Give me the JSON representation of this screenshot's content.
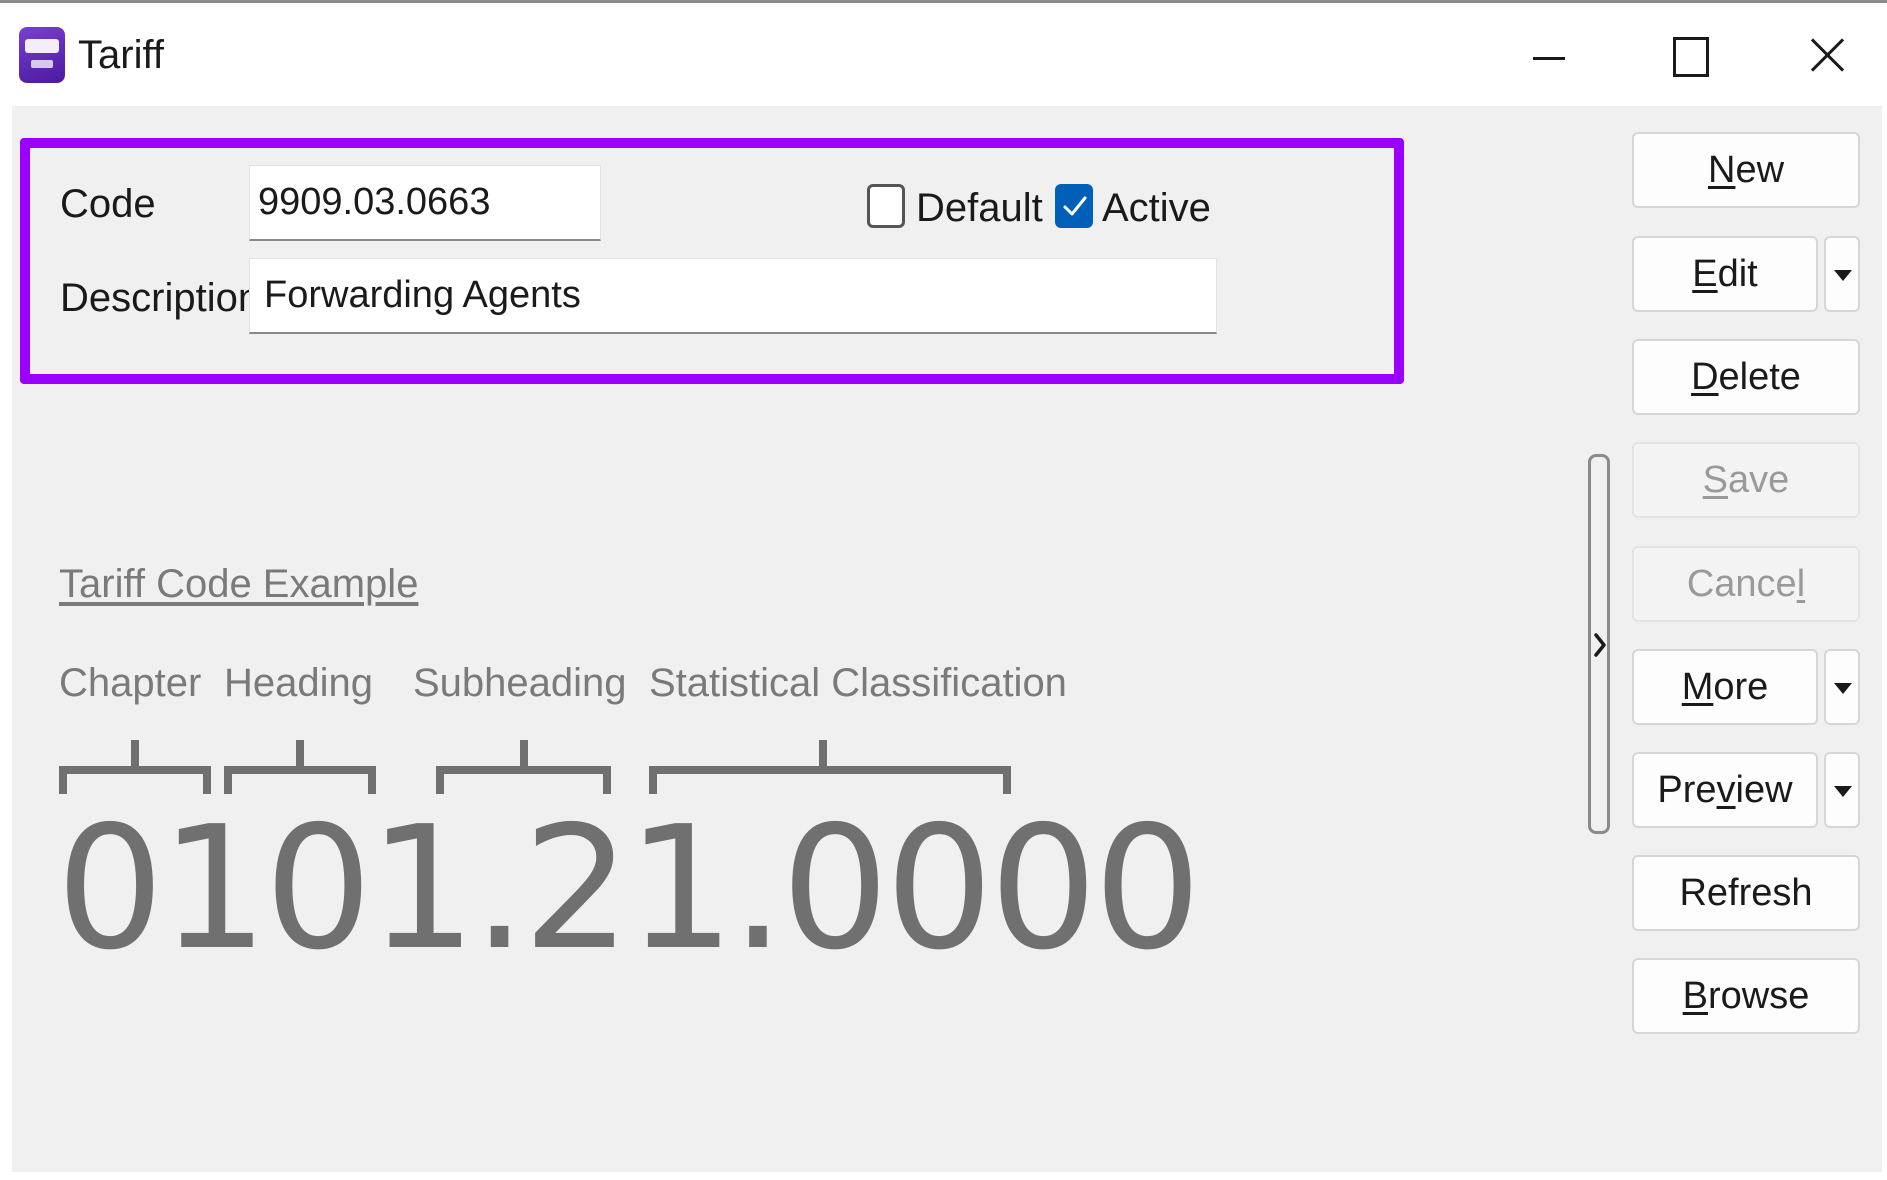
{
  "window": {
    "title": "Tariff",
    "controls": [
      "minimize-icon",
      "maximize-icon",
      "close-icon"
    ],
    "app_icon": "app-logo-icon"
  },
  "form": {
    "code_label": "Code",
    "code_value": "9909.03.0663",
    "description_label": "Description",
    "description_value": "Forwarding Agents",
    "default_label": "Default",
    "default_checked": false,
    "active_label": "Active",
    "active_checked": true
  },
  "example": {
    "link_text": "Tariff Code Example",
    "segments": {
      "chapter": "Chapter",
      "heading": "Heading",
      "subheading": "Subheading",
      "statistical": "Statistical Classification"
    },
    "code": "0101.21.0000"
  },
  "buttons": {
    "new": {
      "before": "",
      "access": "N",
      "after": "ew"
    },
    "edit": {
      "before": "",
      "access": "E",
      "after": "dit"
    },
    "delete": {
      "before": "",
      "access": "D",
      "after": "elete"
    },
    "save": {
      "before": "",
      "access": "S",
      "after": "ave"
    },
    "cancel": {
      "before": "Cance",
      "access": "l",
      "after": ""
    },
    "more": {
      "before": "",
      "access": "M",
      "after": "ore"
    },
    "preview": {
      "before": "Pre",
      "access": "v",
      "after": "iew"
    },
    "refresh": {
      "before": "Refresh",
      "access": "",
      "after": ""
    },
    "browse": {
      "before": "",
      "access": "B",
      "after": "rowse"
    }
  },
  "colors": {
    "highlight": "#9b00ff",
    "checkbox_accent": "#005fb8",
    "example_text": "#707070"
  }
}
